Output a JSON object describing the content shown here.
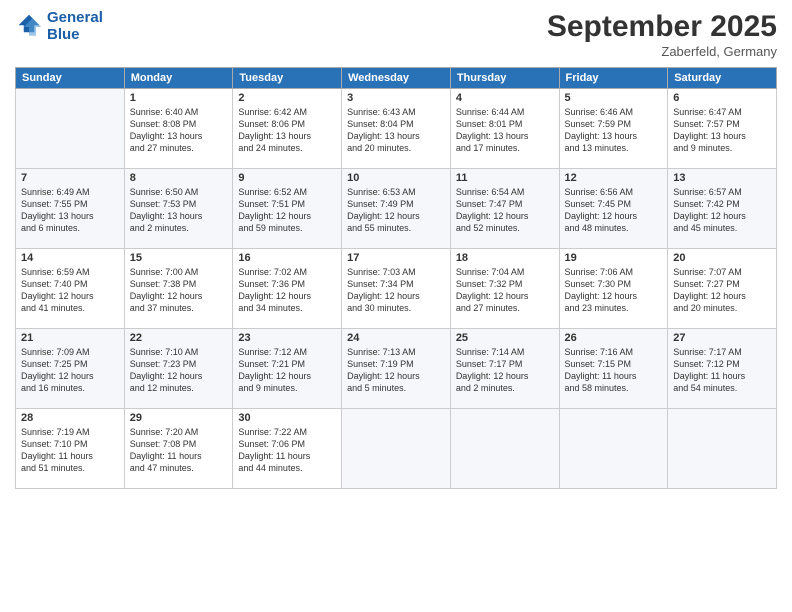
{
  "logo": {
    "line1": "General",
    "line2": "Blue"
  },
  "title": "September 2025",
  "subtitle": "Zaberfeld, Germany",
  "days_of_week": [
    "Sunday",
    "Monday",
    "Tuesday",
    "Wednesday",
    "Thursday",
    "Friday",
    "Saturday"
  ],
  "weeks": [
    [
      {
        "day": "",
        "text": ""
      },
      {
        "day": "1",
        "text": "Sunrise: 6:40 AM\nSunset: 8:08 PM\nDaylight: 13 hours\nand 27 minutes."
      },
      {
        "day": "2",
        "text": "Sunrise: 6:42 AM\nSunset: 8:06 PM\nDaylight: 13 hours\nand 24 minutes."
      },
      {
        "day": "3",
        "text": "Sunrise: 6:43 AM\nSunset: 8:04 PM\nDaylight: 13 hours\nand 20 minutes."
      },
      {
        "day": "4",
        "text": "Sunrise: 6:44 AM\nSunset: 8:01 PM\nDaylight: 13 hours\nand 17 minutes."
      },
      {
        "day": "5",
        "text": "Sunrise: 6:46 AM\nSunset: 7:59 PM\nDaylight: 13 hours\nand 13 minutes."
      },
      {
        "day": "6",
        "text": "Sunrise: 6:47 AM\nSunset: 7:57 PM\nDaylight: 13 hours\nand 9 minutes."
      }
    ],
    [
      {
        "day": "7",
        "text": "Sunrise: 6:49 AM\nSunset: 7:55 PM\nDaylight: 13 hours\nand 6 minutes."
      },
      {
        "day": "8",
        "text": "Sunrise: 6:50 AM\nSunset: 7:53 PM\nDaylight: 13 hours\nand 2 minutes."
      },
      {
        "day": "9",
        "text": "Sunrise: 6:52 AM\nSunset: 7:51 PM\nDaylight: 12 hours\nand 59 minutes."
      },
      {
        "day": "10",
        "text": "Sunrise: 6:53 AM\nSunset: 7:49 PM\nDaylight: 12 hours\nand 55 minutes."
      },
      {
        "day": "11",
        "text": "Sunrise: 6:54 AM\nSunset: 7:47 PM\nDaylight: 12 hours\nand 52 minutes."
      },
      {
        "day": "12",
        "text": "Sunrise: 6:56 AM\nSunset: 7:45 PM\nDaylight: 12 hours\nand 48 minutes."
      },
      {
        "day": "13",
        "text": "Sunrise: 6:57 AM\nSunset: 7:42 PM\nDaylight: 12 hours\nand 45 minutes."
      }
    ],
    [
      {
        "day": "14",
        "text": "Sunrise: 6:59 AM\nSunset: 7:40 PM\nDaylight: 12 hours\nand 41 minutes."
      },
      {
        "day": "15",
        "text": "Sunrise: 7:00 AM\nSunset: 7:38 PM\nDaylight: 12 hours\nand 37 minutes."
      },
      {
        "day": "16",
        "text": "Sunrise: 7:02 AM\nSunset: 7:36 PM\nDaylight: 12 hours\nand 34 minutes."
      },
      {
        "day": "17",
        "text": "Sunrise: 7:03 AM\nSunset: 7:34 PM\nDaylight: 12 hours\nand 30 minutes."
      },
      {
        "day": "18",
        "text": "Sunrise: 7:04 AM\nSunset: 7:32 PM\nDaylight: 12 hours\nand 27 minutes."
      },
      {
        "day": "19",
        "text": "Sunrise: 7:06 AM\nSunset: 7:30 PM\nDaylight: 12 hours\nand 23 minutes."
      },
      {
        "day": "20",
        "text": "Sunrise: 7:07 AM\nSunset: 7:27 PM\nDaylight: 12 hours\nand 20 minutes."
      }
    ],
    [
      {
        "day": "21",
        "text": "Sunrise: 7:09 AM\nSunset: 7:25 PM\nDaylight: 12 hours\nand 16 minutes."
      },
      {
        "day": "22",
        "text": "Sunrise: 7:10 AM\nSunset: 7:23 PM\nDaylight: 12 hours\nand 12 minutes."
      },
      {
        "day": "23",
        "text": "Sunrise: 7:12 AM\nSunset: 7:21 PM\nDaylight: 12 hours\nand 9 minutes."
      },
      {
        "day": "24",
        "text": "Sunrise: 7:13 AM\nSunset: 7:19 PM\nDaylight: 12 hours\nand 5 minutes."
      },
      {
        "day": "25",
        "text": "Sunrise: 7:14 AM\nSunset: 7:17 PM\nDaylight: 12 hours\nand 2 minutes."
      },
      {
        "day": "26",
        "text": "Sunrise: 7:16 AM\nSunset: 7:15 PM\nDaylight: 11 hours\nand 58 minutes."
      },
      {
        "day": "27",
        "text": "Sunrise: 7:17 AM\nSunset: 7:12 PM\nDaylight: 11 hours\nand 54 minutes."
      }
    ],
    [
      {
        "day": "28",
        "text": "Sunrise: 7:19 AM\nSunset: 7:10 PM\nDaylight: 11 hours\nand 51 minutes."
      },
      {
        "day": "29",
        "text": "Sunrise: 7:20 AM\nSunset: 7:08 PM\nDaylight: 11 hours\nand 47 minutes."
      },
      {
        "day": "30",
        "text": "Sunrise: 7:22 AM\nSunset: 7:06 PM\nDaylight: 11 hours\nand 44 minutes."
      },
      {
        "day": "",
        "text": ""
      },
      {
        "day": "",
        "text": ""
      },
      {
        "day": "",
        "text": ""
      },
      {
        "day": "",
        "text": ""
      }
    ]
  ]
}
